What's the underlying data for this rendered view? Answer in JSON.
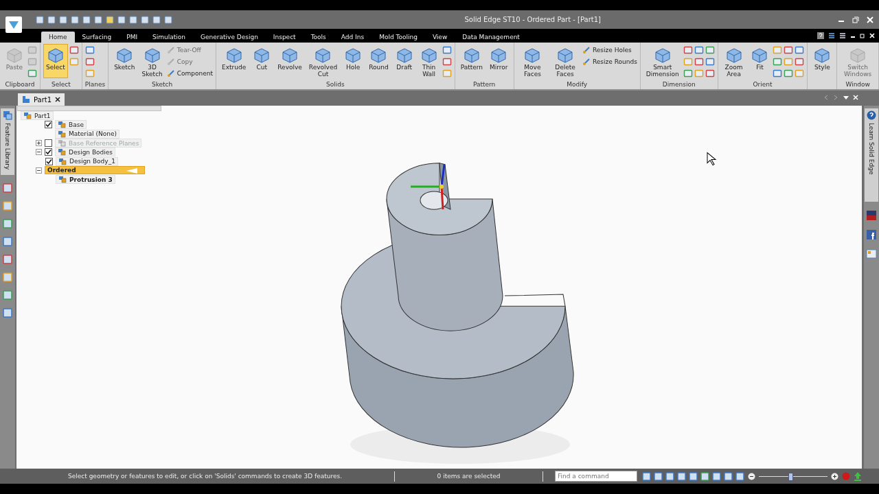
{
  "window": {
    "title": "Solid Edge ST10 - Ordered Part - [Part1]"
  },
  "tabs": [
    {
      "label": "Home",
      "selected": true
    },
    {
      "label": "Surfacing",
      "selected": false
    },
    {
      "label": "PMI",
      "selected": false
    },
    {
      "label": "Simulation",
      "selected": false
    },
    {
      "label": "Generative Design",
      "selected": false
    },
    {
      "label": "Inspect",
      "selected": false
    },
    {
      "label": "Tools",
      "selected": false
    },
    {
      "label": "Add Ins",
      "selected": false
    },
    {
      "label": "Mold Tooling",
      "selected": false
    },
    {
      "label": "View",
      "selected": false
    },
    {
      "label": "Data Management",
      "selected": false
    }
  ],
  "ribbon": [
    {
      "label": "Clipboard",
      "items": [
        {
          "kind": "large",
          "label": "Paste",
          "disabled": true,
          "selected": false
        },
        {
          "kind": "icon",
          "disabled": true
        },
        {
          "kind": "icon",
          "disabled": true
        },
        {
          "kind": "icon",
          "disabled": false
        }
      ]
    },
    {
      "label": "Select",
      "items": [
        {
          "kind": "large",
          "label": "Select",
          "disabled": false,
          "selected": true
        },
        {
          "kind": "icon",
          "disabled": false
        },
        {
          "kind": "icon",
          "disabled": false
        }
      ]
    },
    {
      "label": "Planes",
      "items": [
        {
          "kind": "icon",
          "disabled": false
        },
        {
          "kind": "icon",
          "disabled": false
        },
        {
          "kind": "icon",
          "disabled": false
        }
      ]
    },
    {
      "label": "Sketch",
      "items": [
        {
          "kind": "large",
          "label": "Sketch",
          "disabled": false,
          "selected": false
        },
        {
          "kind": "large",
          "label": "3D Sketch",
          "disabled": false,
          "selected": false
        },
        {
          "kind": "small",
          "label": "Tear-Off",
          "disabled": true
        },
        {
          "kind": "small",
          "label": "Copy",
          "disabled": true
        },
        {
          "kind": "small",
          "label": "Component",
          "disabled": false
        }
      ]
    },
    {
      "label": "Solids",
      "items": [
        {
          "kind": "large",
          "label": "Extrude",
          "disabled": false,
          "selected": false
        },
        {
          "kind": "large",
          "label": "Cut",
          "disabled": false,
          "selected": false
        },
        {
          "kind": "large",
          "label": "Revolve",
          "disabled": false,
          "selected": false
        },
        {
          "kind": "large",
          "label": "Revolved Cut",
          "disabled": false,
          "selected": false
        },
        {
          "kind": "large",
          "label": "Hole",
          "disabled": false,
          "selected": false
        },
        {
          "kind": "large",
          "label": "Round",
          "disabled": false,
          "selected": false
        },
        {
          "kind": "large",
          "label": "Draft",
          "disabled": false,
          "selected": false
        },
        {
          "kind": "large",
          "label": "Thin Wall",
          "disabled": false,
          "selected": false
        },
        {
          "kind": "icon",
          "disabled": false
        },
        {
          "kind": "icon",
          "disabled": false
        },
        {
          "kind": "icon",
          "disabled": false
        }
      ]
    },
    {
      "label": "Pattern",
      "items": [
        {
          "kind": "large",
          "label": "Pattern",
          "disabled": false,
          "selected": false
        },
        {
          "kind": "large",
          "label": "Mirror",
          "disabled": false,
          "selected": false
        }
      ]
    },
    {
      "label": "Modify",
      "items": [
        {
          "kind": "large",
          "label": "Move Faces",
          "disabled": false,
          "selected": false
        },
        {
          "kind": "large",
          "label": "Delete Faces",
          "disabled": false,
          "selected": false
        },
        {
          "kind": "small",
          "label": "Resize Holes",
          "disabled": false
        },
        {
          "kind": "small",
          "label": "Resize Rounds",
          "disabled": false
        }
      ]
    },
    {
      "label": "Dimension",
      "items": [
        {
          "kind": "large",
          "label": "Smart Dimension",
          "disabled": false,
          "selected": false
        },
        {
          "kind": "icon",
          "disabled": false
        },
        {
          "kind": "icon",
          "disabled": false
        },
        {
          "kind": "icon",
          "disabled": false
        },
        {
          "kind": "icon",
          "disabled": false
        },
        {
          "kind": "icon",
          "disabled": false
        },
        {
          "kind": "icon",
          "disabled": false
        },
        {
          "kind": "icon",
          "disabled": false
        },
        {
          "kind": "icon",
          "disabled": false
        },
        {
          "kind": "icon",
          "disabled": false
        }
      ]
    },
    {
      "label": "Orient",
      "items": [
        {
          "kind": "large",
          "label": "Zoom Area",
          "disabled": false,
          "selected": false
        },
        {
          "kind": "large",
          "label": "Fit",
          "disabled": false,
          "selected": false
        },
        {
          "kind": "icon",
          "disabled": false
        },
        {
          "kind": "icon",
          "disabled": false
        },
        {
          "kind": "icon",
          "disabled": false
        },
        {
          "kind": "icon",
          "disabled": false
        },
        {
          "kind": "icon",
          "disabled": false
        },
        {
          "kind": "icon",
          "disabled": false
        },
        {
          "kind": "icon",
          "disabled": false
        },
        {
          "kind": "icon",
          "disabled": false
        },
        {
          "kind": "icon",
          "disabled": false
        }
      ]
    },
    {
      "items": [
        {
          "kind": "large",
          "label": "Style",
          "disabled": false,
          "selected": false
        }
      ]
    },
    {
      "label": "Window",
      "items": [
        {
          "kind": "large",
          "label": "Switch Windows",
          "disabled": true,
          "selected": false
        }
      ]
    }
  ],
  "document_tab": {
    "label": "Part1"
  },
  "left_panel_tab": {
    "label": "Feature Library"
  },
  "right_panel_tab": {
    "label": "Learn Solid Edge"
  },
  "tree": [
    {
      "label": "Part1",
      "selected": false,
      "children": [
        {
          "label": "Base",
          "checked": true,
          "selected": false
        },
        {
          "label": "Material (None)",
          "selected": false
        },
        {
          "label": "Base Reference Planes",
          "checked": false,
          "expanded": false,
          "disabled": true,
          "selected": false
        },
        {
          "label": "Design Bodies",
          "checked": true,
          "expanded": true,
          "selected": false,
          "children": [
            {
              "label": "Design Body_1",
              "checked": true,
              "selected": false
            }
          ]
        },
        {
          "label": "Ordered",
          "expanded": true,
          "selected": true,
          "children": [
            {
              "label": "Protrusion 3",
              "selected": false
            }
          ]
        }
      ]
    }
  ],
  "status_bar": {
    "message": "Select geometry or features to edit, or click on 'Solids' commands to create 3D features.",
    "selection": "0 items are selected",
    "command_search": {
      "placeholder": "Find a command"
    },
    "zoom": {
      "level": 0.45
    }
  }
}
